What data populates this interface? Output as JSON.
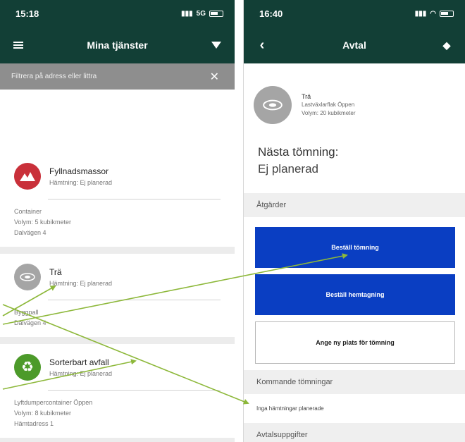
{
  "left": {
    "status_time": "15:18",
    "status_network": "5G",
    "title": "Mina tjänster",
    "filter_placeholder": "Filtrera på adress eller littra",
    "services": [
      {
        "title": "Fyllnadsmassor",
        "pickup": "Hämtning: Ej planerad",
        "icon": "mountain-icon",
        "icon_color": "#c9303a",
        "details": [
          "Container",
          "Volym: 5 kubikmeter",
          "Dalvägen 4"
        ]
      },
      {
        "title": "Trä",
        "pickup": "Hämtning: Ej planerad",
        "icon": "wood-icon",
        "icon_color": "#a5a5a5",
        "details": [
          "Byggpall",
          "Dalvägen 4"
        ]
      },
      {
        "title": "Sorterbart avfall",
        "pickup": "Hämtning: Ej planerad",
        "icon": "recycle-icon",
        "icon_color": "#4c9a2a",
        "details": [
          "Lyftdumpercontainer Öppen",
          "Volym: 8 kubikmeter",
          "Hämtadress 1"
        ]
      }
    ]
  },
  "right": {
    "status_time": "16:40",
    "title": "Avtal",
    "service_title": "Trä",
    "service_type": "Lastväxlarflak Öppen",
    "service_volume": "Volym: 20 kubikmeter",
    "next_label": "Nästa tömning:",
    "next_value": "Ej planerad",
    "actions_header": "Åtgärder",
    "btn_order_emptying": "Beställ tömning",
    "btn_order_pickup": "Beställ hemtagning",
    "btn_new_location": "Ange ny plats för tömning",
    "upcoming_header": "Kommande tömningar",
    "upcoming_empty": "Inga hämtningar planerade",
    "contract_header": "Avtalsuppgifter"
  },
  "colors": {
    "header_bg": "#123f36",
    "primary_button": "#0a3ec2",
    "annotation_arrow": "#8db83a"
  }
}
